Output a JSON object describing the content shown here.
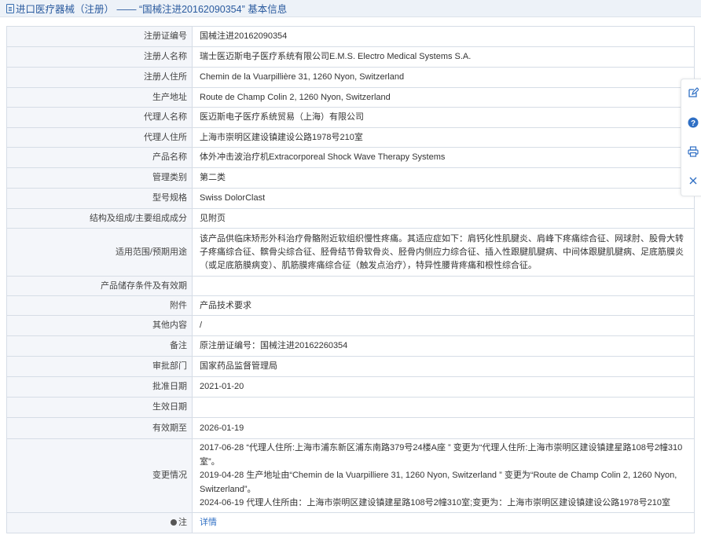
{
  "header": {
    "title": "进口医疗器械（注册） —— “国械注进20162090354” 基本信息",
    "icon": "document-icon"
  },
  "rows": [
    {
      "label": "注册证编号",
      "value": "国械注进20162090354"
    },
    {
      "label": "注册人名称",
      "value": "瑞士医迈斯电子医疗系统有限公司E.M.S. Electro Medical Systems S.A."
    },
    {
      "label": "注册人住所",
      "value": "Chemin de la Vuarpillière 31, 1260 Nyon, Switzerland"
    },
    {
      "label": "生产地址",
      "value": "Route de Champ Colin 2, 1260 Nyon, Switzerland"
    },
    {
      "label": "代理人名称",
      "value": "医迈斯电子医疗系统贸易（上海）有限公司"
    },
    {
      "label": "代理人住所",
      "value": "上海市崇明区建设镇建设公路1978号210室"
    },
    {
      "label": "产品名称",
      "value": "体外冲击波治疗机Extracorporeal Shock Wave Therapy Systems"
    },
    {
      "label": "管理类别",
      "value": "第二类"
    },
    {
      "label": "型号规格",
      "value": "Swiss DolorClast"
    },
    {
      "label": "结构及组成/主要组成成分",
      "value": "见附页"
    },
    {
      "label": "适用范围/预期用途",
      "value": "该产品供临床矫形外科治疗骨骼附近软组织慢性疼痛。其适应症如下：肩钙化性肌腱炎、肩峰下疼痛综合征、网球肘、股骨大转子疼痛综合征、髌骨尖综合征、胫骨结节骨软骨炎、胫骨内侧应力综合征、插入性跟腱肌腱病、中间体跟腱肌腱病、足底筋膜炎（或足底筋膜病变）、肌筋膜疼痛综合征（触发点治疗），特异性腰背疼痛和根性综合征。"
    },
    {
      "label": "产品储存条件及有效期",
      "value": ""
    },
    {
      "label": "附件",
      "value": "产品技术要求"
    },
    {
      "label": "其他内容",
      "value": "/"
    },
    {
      "label": "备注",
      "value": "原注册证编号：国械注进20162260354"
    },
    {
      "label": "审批部门",
      "value": "国家药品监督管理局"
    },
    {
      "label": "批准日期",
      "value": "2021-01-20"
    },
    {
      "label": "生效日期",
      "value": ""
    },
    {
      "label": "有效期至",
      "value": "2026-01-19"
    }
  ],
  "changes": {
    "label": "变更情况",
    "line1": "2017-06-28 “代理人住所:上海市浦东新区浦东南路379号24楼A座 ” 变更为“代理人住所:上海市崇明区建设镇建星路108号2幢310室”。",
    "line2": "2019-04-28 生产地址由“Chemin de la Vuarpilliere 31, 1260 Nyon, Switzerland ” 变更为“Route de Champ Colin 2, 1260 Nyon, Switzerland”。",
    "line3": "2024-06-19 代理人住所由：上海市崇明区建设镇建星路108号2幢310室;变更为：上海市崇明区建设镇建设公路1978号210室"
  },
  "note": {
    "label": "注",
    "link": "详情"
  },
  "side_tools": [
    "edit-icon",
    "help-icon",
    "print-icon",
    "close-icon"
  ],
  "colors": {
    "link": "#2f6fc4",
    "header_text": "#2a5a9e",
    "label_bg": "#f4f6fa",
    "border": "#d6dde6"
  }
}
